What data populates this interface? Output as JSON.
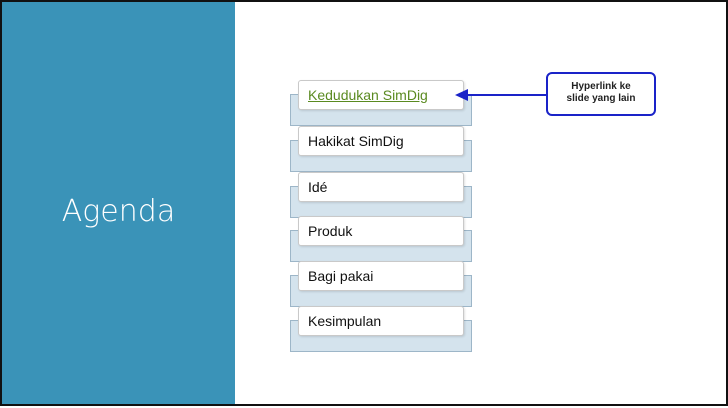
{
  "slide": {
    "title": "Agenda",
    "items": [
      {
        "label": "Kedudukan SimDig",
        "is_link": true
      },
      {
        "label": "Hakikat SimDig",
        "is_link": false
      },
      {
        "label": "Idé",
        "is_link": false
      },
      {
        "label": "Produk",
        "is_link": false
      },
      {
        "label": "Bagi pakai",
        "is_link": false
      },
      {
        "label": "Kesimpulan",
        "is_link": false
      }
    ],
    "callout": {
      "line1": "Hyperlink ke",
      "line2": "slide yang lain"
    },
    "colors": {
      "panel": "#3a93b8",
      "link": "#5a8a20",
      "callout_border": "#1a23c8",
      "item_back": "#d4e3ed"
    }
  }
}
